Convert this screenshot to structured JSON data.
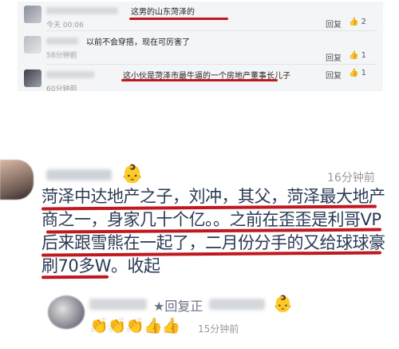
{
  "top": {
    "comments": [
      {
        "text": "这男的山东菏泽的",
        "time": "今天 00:06",
        "reply": "回复",
        "likes": "2"
      },
      {
        "text": "以前不会穿搭，现在可厉害了",
        "time": "58分钟前",
        "reply": "回复",
        "likes": "1"
      },
      {
        "text": "这小伙是菏泽市最牛逼的一个房地产董事长儿子",
        "time": "60分钟前",
        "reply": "回复",
        "likes": "1"
      }
    ],
    "like_icon": "thumbs-up-icon"
  },
  "main_comment": {
    "badge": "👶",
    "time": "16分钟前",
    "lines": [
      "菏泽中达地产之子，刘冲，其父，菏泽最大地产",
      "商之一，身家几十个亿。。之前在歪歪是利哥VP",
      "后来跟雪熊在一起了，二月份分手的又给球球豪",
      "刷70多W。"
    ],
    "collapse_label": "收起",
    "underline_color": "#c0181f"
  },
  "reply": {
    "reply_label": "★回复正",
    "badge": "👶",
    "emojis": "👏👏👏👍👍",
    "time": "15分钟前"
  }
}
